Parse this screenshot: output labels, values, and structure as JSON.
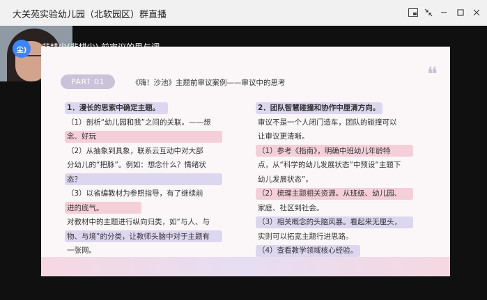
{
  "window": {
    "title": "大关苑实验幼儿园（北软园区）群直播"
  },
  "camera": {
    "badge": "尘)"
  },
  "speaker_caption": "裴耕尘(裴耕尘) 前审议的思与调",
  "slide": {
    "part": "PART 01",
    "title": "《嗨！沙池》主题前审议案例——审议中的思考",
    "left": {
      "heading": "1．漫长的思索中确定主题。",
      "lines": [
        "（1）剖析“幼儿园和我”之间的关联。——想",
        "念、好玩",
        "（2）从抽象到具象，联系云互动中对大部",
        "分幼儿的“把脉”。例如：想念什么？情绪状",
        "态？",
        "（3）以省编教材为参照指导，有了继续前",
        "进的底气。",
        "对教材中的主题进行纵向归类，如“与人、与",
        "物、与境”的分类，让教师头脑中对于主题有",
        "一张网。"
      ]
    },
    "right": {
      "heading": "2．团队智慧碰撞和协作中厘清方向。",
      "lines": [
        "审议不是一个人闭门造车，团队的碰撞可以",
        "让审议更清晰。",
        "（1）参考《指南》，明确中班幼儿年龄特",
        "点，从“科学的幼儿发展状态”中预设“主题下",
        "幼儿发展状态”。",
        "（2）梳理主题相关资源。从班级、幼儿园、",
        "家庭、社区到社会。",
        "（3）相关概念的头脑风暴。看起来无厘头，",
        "实则可以拓宽主题行进思路。",
        "（4）查看教学领域核心经验。"
      ]
    }
  }
}
